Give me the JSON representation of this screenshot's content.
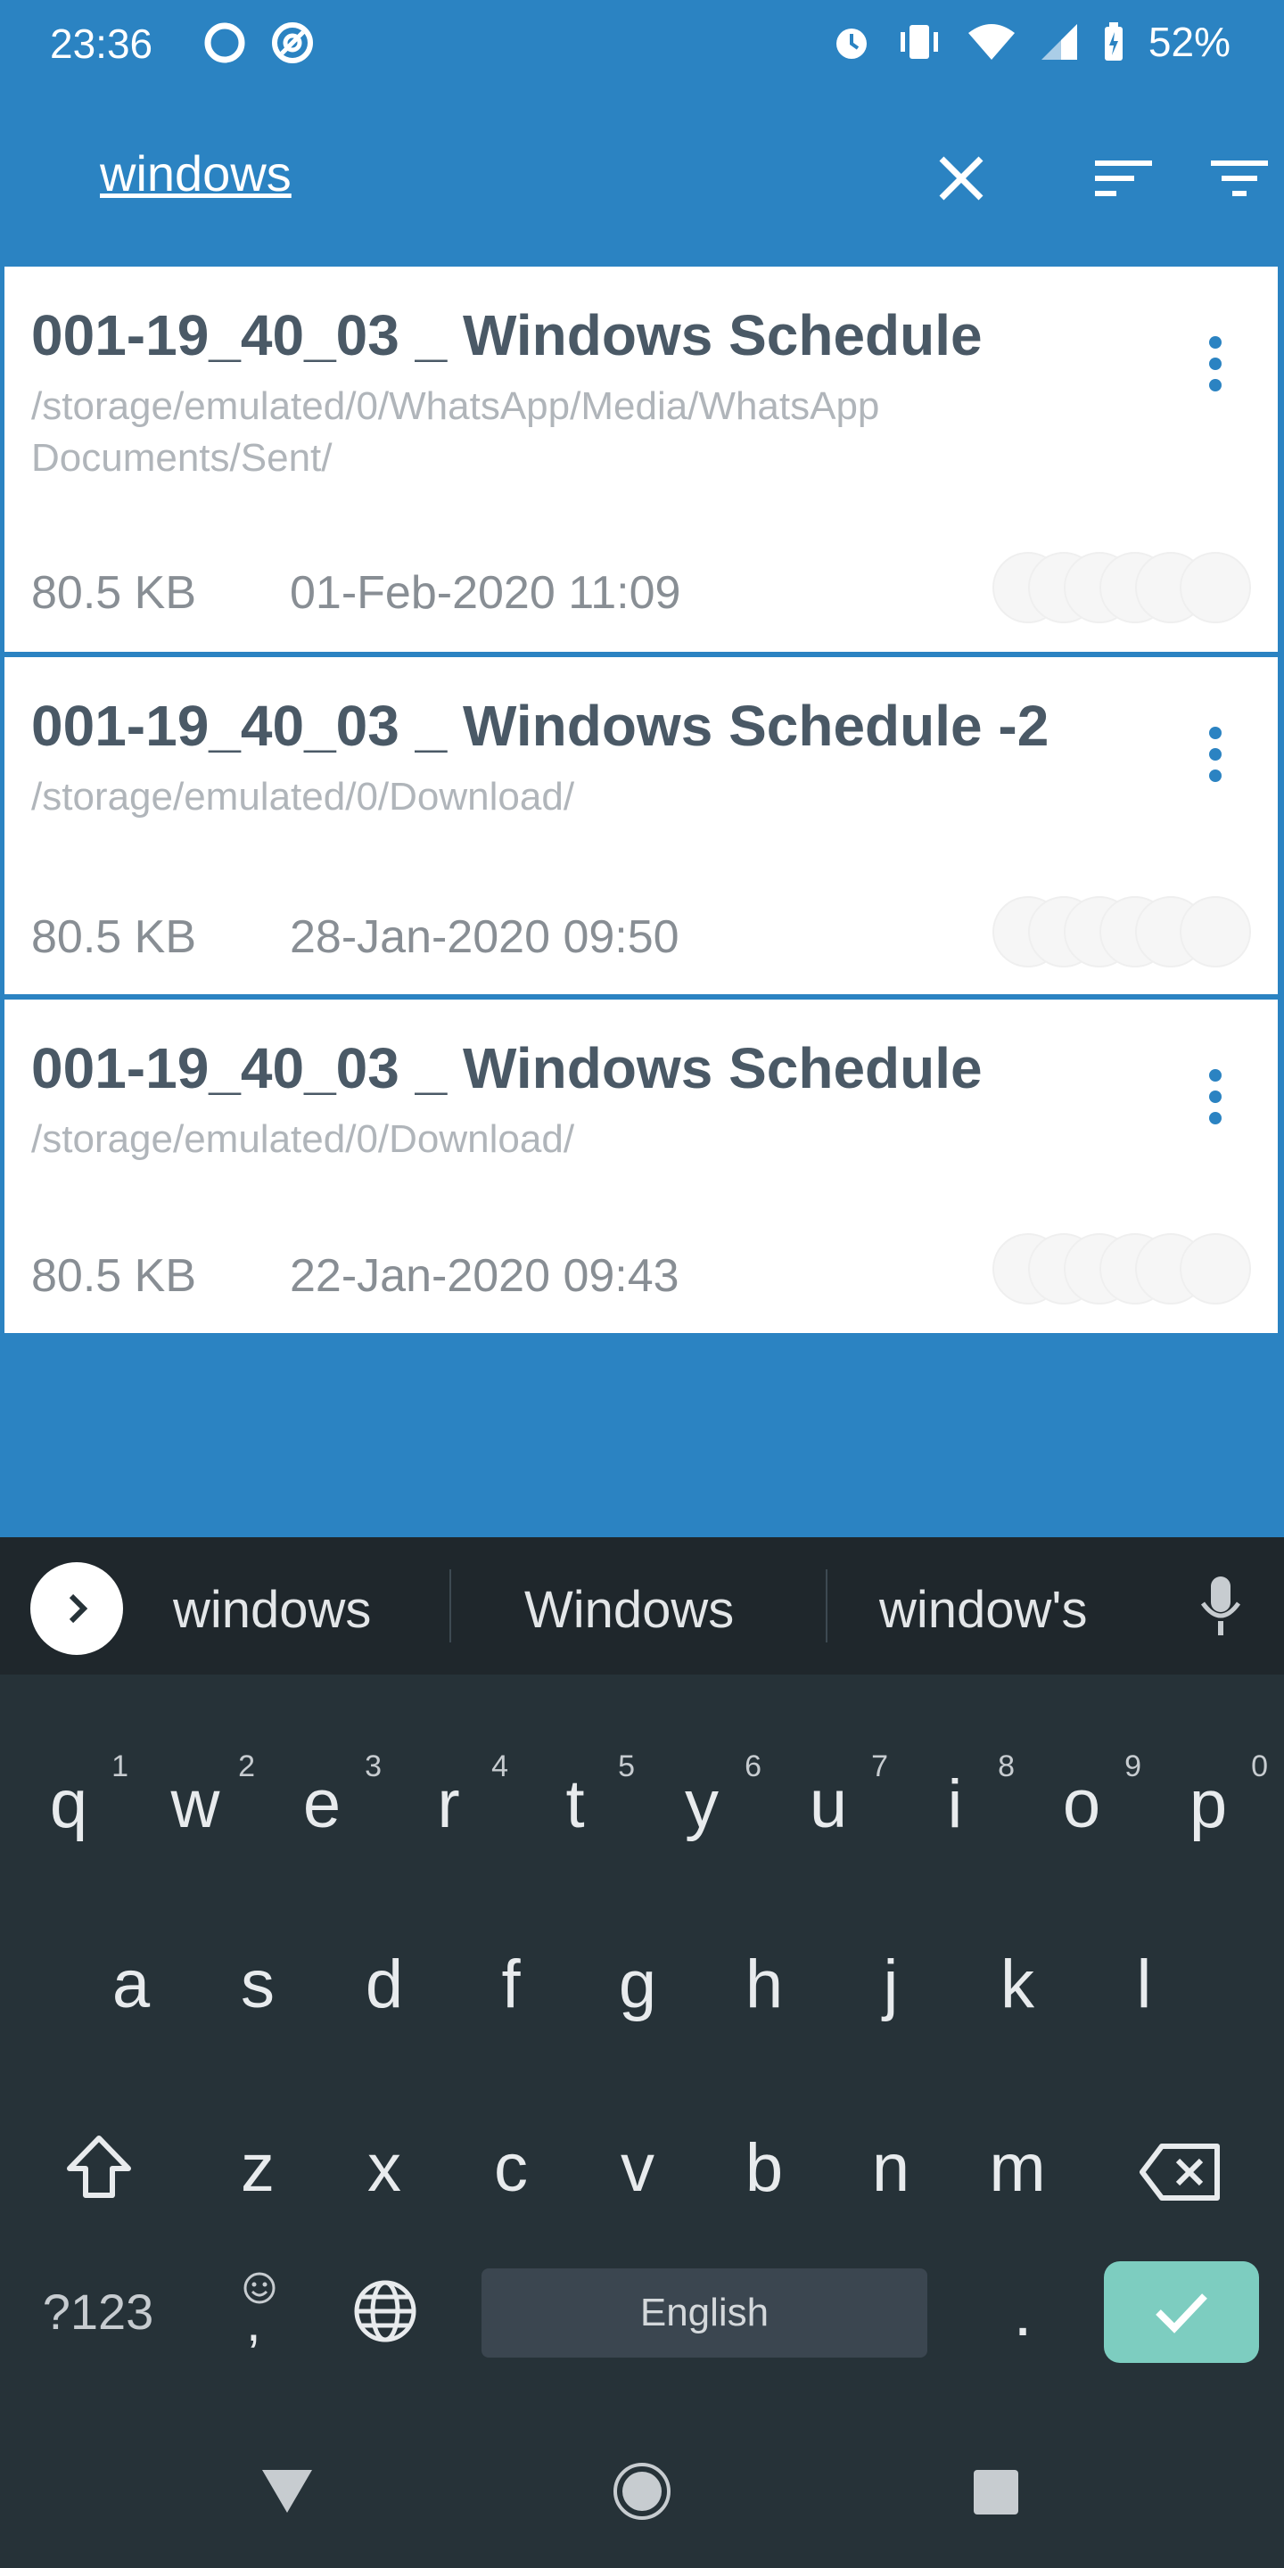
{
  "status_bar": {
    "time": "23:36",
    "battery": "52%",
    "icons": [
      "sync-icon",
      "at-sign-icon",
      "alarm-icon",
      "vibrate-icon",
      "wifi-icon",
      "signal-icon",
      "battery-icon"
    ]
  },
  "app_bar": {
    "search_text": "windows",
    "icons": [
      "close-icon",
      "sort-icon",
      "filter-icon"
    ]
  },
  "results": [
    {
      "name": "001-19_40_03 _  Windows Schedule",
      "path": "/storage/emulated/0/WhatsApp/Media/WhatsApp Documents/Sent/",
      "size": "80.5 KB",
      "date": "01-Feb-2020 11:09"
    },
    {
      "name": "001-19_40_03 _  Windows Schedule -2",
      "path": "/storage/emulated/0/Download/",
      "size": "80.5 KB",
      "date": "28-Jan-2020 09:50"
    },
    {
      "name": "001-19_40_03 _  Windows Schedule",
      "path": "/storage/emulated/0/Download/",
      "size": "80.5 KB",
      "date": "22-Jan-2020 09:43"
    }
  ],
  "keyboard": {
    "suggestions": [
      "windows",
      "Windows",
      "window's"
    ],
    "row1": [
      "q",
      "w",
      "e",
      "r",
      "t",
      "y",
      "u",
      "i",
      "o",
      "p"
    ],
    "row1_hints": [
      "1",
      "2",
      "3",
      "4",
      "5",
      "6",
      "7",
      "8",
      "9",
      "0"
    ],
    "row2": [
      "a",
      "s",
      "d",
      "f",
      "g",
      "h",
      "j",
      "k",
      "l"
    ],
    "row3": [
      "z",
      "x",
      "c",
      "v",
      "b",
      "n",
      "m"
    ],
    "symbols_label": "?123",
    "comma_label": ",",
    "space_label": "English",
    "period_label": "."
  },
  "colors": {
    "primary": "#2b83c2",
    "keyboard_bg": "#263238",
    "enter_key": "#7dcdc0"
  }
}
